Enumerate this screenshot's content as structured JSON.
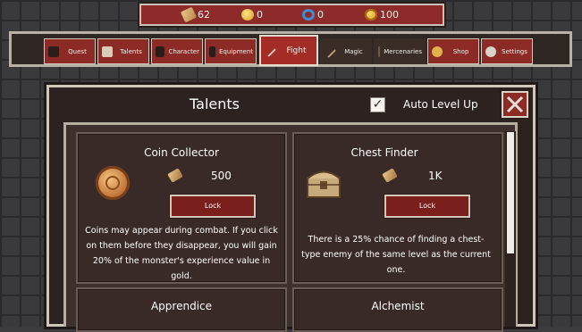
{
  "resources": [
    {
      "icon": "scroll-icon",
      "value": "62"
    },
    {
      "icon": "coin-icon",
      "value": "0"
    },
    {
      "icon": "cycle-icon",
      "value": "0"
    },
    {
      "icon": "gold-coin-icon",
      "value": "100"
    }
  ],
  "nav": {
    "tabs": [
      {
        "label": "Quest",
        "icon": "quest-icon"
      },
      {
        "label": "Talents",
        "icon": "talents-icon"
      },
      {
        "label": "Character",
        "icon": "character-icon"
      },
      {
        "label": "Equipment",
        "icon": "equipment-icon"
      },
      {
        "label": "Fight",
        "icon": "sword-icon",
        "active": true
      },
      {
        "label": "Magic",
        "icon": "wand-icon"
      },
      {
        "label": "Mercenaries",
        "icon": "mercenaries-icon"
      },
      {
        "label": "Shop",
        "icon": "shop-icon"
      },
      {
        "label": "Settings",
        "icon": "settings-icon"
      }
    ]
  },
  "dialog": {
    "title": "Talents",
    "auto_level_label": "Auto Level Up",
    "auto_level_checked": true,
    "checkmark": "✓"
  },
  "talents": [
    {
      "name": "Coin Collector",
      "cost": "500",
      "button": "Lock",
      "description": "Coins may appear during combat. If you click on them before they disappear, you will gain 20% of the monster's experience value in gold."
    },
    {
      "name": "Chest Finder",
      "cost": "1K",
      "button": "Lock",
      "description": "There is a 25% chance of finding a chest-type enemy of the same level as the current one."
    },
    {
      "name": "Apprendice"
    },
    {
      "name": "Alchemist"
    }
  ],
  "colors": {
    "button_red": "#8c2a26",
    "panel_dark": "#2c2320",
    "frame_light": "#cfc7ba"
  }
}
